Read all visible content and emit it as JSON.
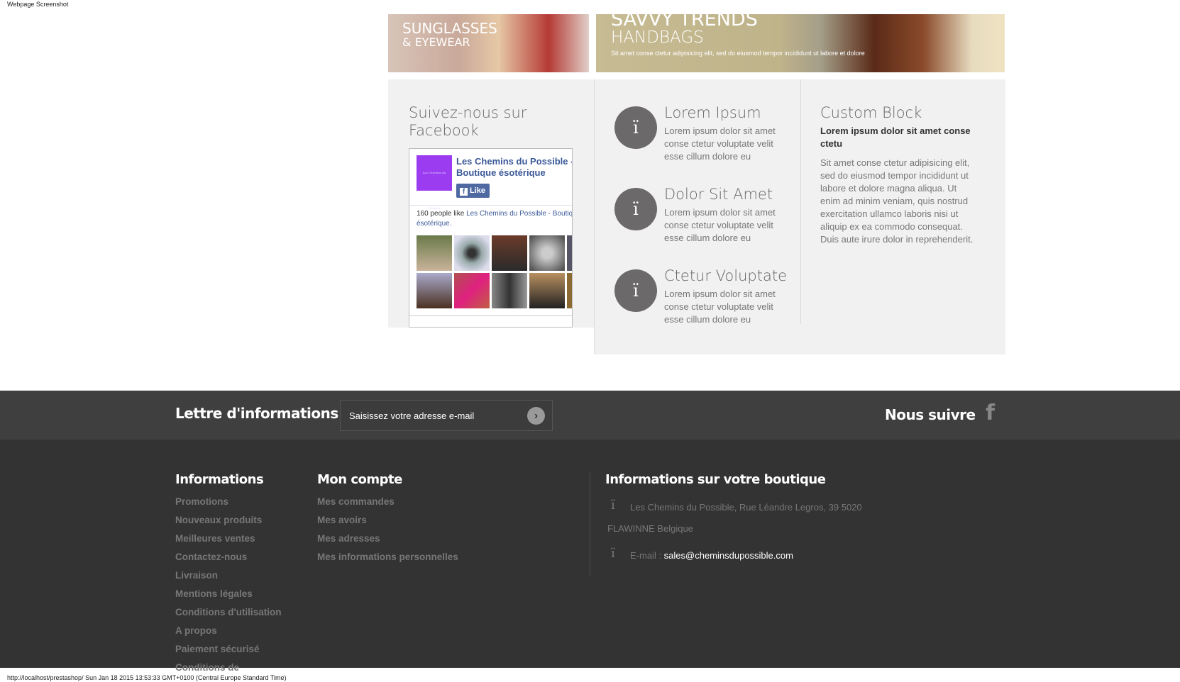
{
  "caption": "Webpage Screenshot",
  "banners": [
    {
      "title": "SUNGLASSES",
      "subtitle": "& EYEWEAR"
    },
    {
      "title": "SAVVY TRENDS",
      "subtitle": "HANDBAGS",
      "text": "Sit amet conse ctetur adipisicing elit, sed do eiusmod tempor incididunt ut labore et dolore"
    }
  ],
  "facebook": {
    "heading": "Suivez-nous sur Facebook",
    "logo_text": "Les Chemins du Possible",
    "page_name": "Les Chemins du Possible - Boutique ésotérique",
    "like_label": "Like",
    "likes_prefix": "160 people like ",
    "likes_page": "Les Chemins du Possible - Boutique ésotérique."
  },
  "info_blocks": [
    {
      "icon": "info-icon",
      "glyph": "ï",
      "title": "Lorem Ipsum",
      "text": "Lorem ipsum dolor sit amet conse ctetur voluptate velit esse cillum dolore eu"
    },
    {
      "icon": "info-icon",
      "glyph": "ï",
      "title": "Dolor Sit Amet",
      "text": "Lorem ipsum dolor sit amet conse ctetur voluptate velit esse cillum dolore eu"
    },
    {
      "icon": "info-icon",
      "glyph": "ï",
      "title": "Ctetur Voluptate",
      "text": "Lorem ipsum dolor sit amet conse ctetur voluptate velit esse cillum dolore eu"
    }
  ],
  "custom_block": {
    "title": "Custom Block",
    "lead": "Lorem ipsum dolor sit amet conse ctetu",
    "text": "Sit amet conse ctetur adipisicing elit, sed do eiusmod tempor incididunt ut labore et dolore magna aliqua. Ut enim ad minim veniam, quis nostrud exercitation ullamco laboris nisi ut aliquip ex ea commodo consequat. Duis aute irure dolor in reprehenderit."
  },
  "newsletter": {
    "title": "Lettre d'informations",
    "placeholder": "Saisissez votre adresse e-mail",
    "follow": "Nous suivre"
  },
  "footer": {
    "informations": {
      "title": "Informations",
      "links": [
        "Promotions",
        "Nouveaux produits",
        "Meilleures ventes",
        "Contactez-nous",
        "Livraison",
        "Mentions légales",
        "Conditions d'utilisation",
        "A propos",
        "Paiement sécurisé",
        "Conditions de"
      ]
    },
    "account": {
      "title": "Mon compte",
      "links": [
        "Mes commandes",
        "Mes avoirs",
        "Mes adresses",
        "Mes informations personnelles"
      ]
    },
    "store": {
      "title": "Informations sur votre boutique",
      "glyph": "ï",
      "address1": "Les Chemins du Possible, Rue Léandre Legros, 39 5020",
      "address2": "FLAWINNE Belgique",
      "email_label": "E-mail : ",
      "email": "sales@cheminsdupossible.com"
    }
  },
  "status": "http://localhost/prestashop/ Sun Jan 18 2015 13:53:33 GMT+0100 (Central Europe Standard Time)",
  "colors": {
    "footer": "#333333",
    "newsletter": "#3f3f3f",
    "panel": "#f1f1f1",
    "fb_blue": "#3b5998",
    "icon_circle": "#6b6969"
  }
}
